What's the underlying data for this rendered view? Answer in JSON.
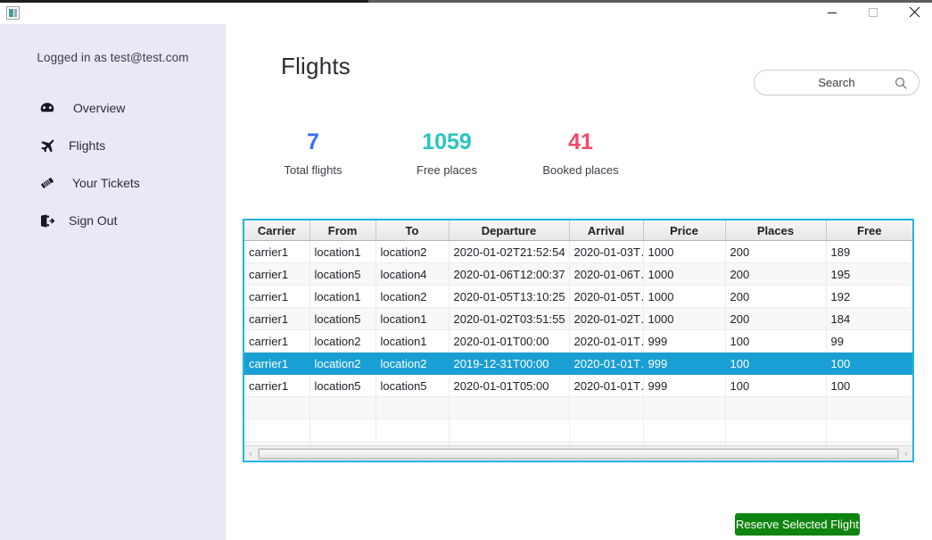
{
  "window": {
    "app_icon": "app-icon",
    "controls": {
      "minimize": "minimize",
      "maximize": "maximize",
      "close": "close"
    }
  },
  "sidebar": {
    "logged_in_text": "Logged in as test@test.com",
    "items": [
      {
        "label": "Overview",
        "icon": "dashboard-icon"
      },
      {
        "label": "Flights",
        "icon": "plane-icon"
      },
      {
        "label": "Your Tickets",
        "icon": "ticket-icon"
      },
      {
        "label": "Sign Out",
        "icon": "sign-out-icon"
      }
    ]
  },
  "main": {
    "page_title": "Flights",
    "search": {
      "placeholder": "Search",
      "value": "",
      "icon": "search-icon"
    },
    "stats": [
      {
        "value": "7",
        "label": "Total flights",
        "color": "#3b6ef5"
      },
      {
        "value": "1059",
        "label": "Free places",
        "color": "#28c4bf"
      },
      {
        "value": "41",
        "label": "Booked places",
        "color": "#f2486b"
      }
    ],
    "table": {
      "columns": [
        "Carrier",
        "From",
        "To",
        "Departure",
        "Arrival",
        "Price",
        "Places",
        "Free"
      ],
      "rows": [
        [
          "carrier1",
          "location1",
          "location2",
          "2020-01-02T21:52:54",
          "2020-01-03T…",
          "1000",
          "200",
          "189"
        ],
        [
          "carrier1",
          "location5",
          "location4",
          "2020-01-06T12:00:37",
          "2020-01-06T…",
          "1000",
          "200",
          "195"
        ],
        [
          "carrier1",
          "location1",
          "location2",
          "2020-01-05T13:10:25",
          "2020-01-05T…",
          "1000",
          "200",
          "192"
        ],
        [
          "carrier1",
          "location5",
          "location1",
          "2020-01-02T03:51:55",
          "2020-01-02T…",
          "1000",
          "200",
          "184"
        ],
        [
          "carrier1",
          "location2",
          "location1",
          "2020-01-01T00:00",
          "2020-01-01T…",
          "999",
          "100",
          "99"
        ],
        [
          "carrier1",
          "location2",
          "location2",
          "2019-12-31T00:00",
          "2020-01-01T…",
          "999",
          "100",
          "100"
        ],
        [
          "carrier1",
          "location5",
          "location5",
          "2020-01-01T05:00",
          "2020-01-01T…",
          "999",
          "100",
          "100"
        ]
      ],
      "selected_row_index": 5,
      "empty_row_count": 3,
      "selection_color": "#1a9fd4",
      "border_color": "#23b3e8",
      "scrollbar": {
        "left_arrow": "‹",
        "right_arrow": "›"
      }
    },
    "reserve_button_label": "Reserve Selected Flight",
    "reserve_button_color": "#108410"
  }
}
